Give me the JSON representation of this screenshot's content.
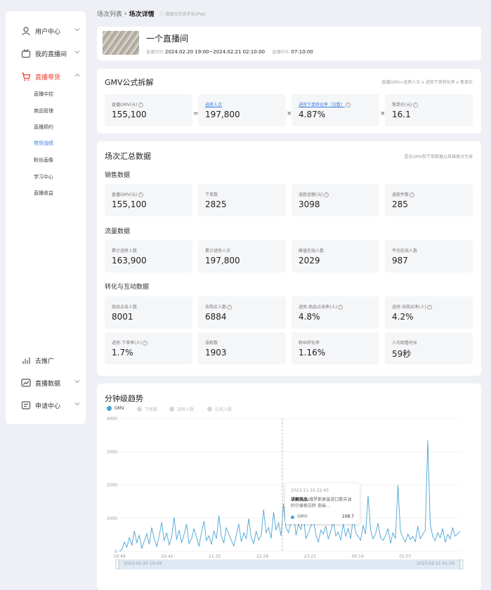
{
  "sidebar": {
    "items": [
      {
        "label": "用户中心",
        "icon": "user-circle-icon"
      },
      {
        "label": "我的直播间",
        "icon": "live-room-icon"
      },
      {
        "label": "直播带货",
        "icon": "shopping-cart-icon"
      },
      {
        "label": "去推广",
        "icon": "bar-chart-icon"
      },
      {
        "label": "直播数据",
        "icon": "line-chart-icon"
      },
      {
        "label": "申请中心",
        "icon": "application-icon"
      }
    ],
    "sub_items": [
      "直播中控",
      "商品管理",
      "直播预约",
      "带货战绩",
      "粉丝画像",
      "学习中心",
      "直播收益"
    ],
    "active_color": "#e8402f"
  },
  "breadcrumb": {
    "parent": "场次列表",
    "current": "场次详情",
    "hint": "数据仅包含手机/iPad"
  },
  "room": {
    "name": "一个直播间",
    "time_key": "直播时间",
    "time_value": "2024.02.20 19:00~2024.02.21 02:10:00",
    "duration_key": "直播时长",
    "duration_value": "07:10:00"
  },
  "gmv": {
    "title": "GMV公式拆解",
    "note": "直播GMV=进房人次 x 进房下单转化率 x 笔单价",
    "items": [
      {
        "label": "直播GMV(元)",
        "value": "155,100",
        "link": false
      },
      {
        "label": "进房人次",
        "value": "197,800",
        "link": true
      },
      {
        "label": "进房下单转化率（次数）",
        "value": "4.87%",
        "link": true
      },
      {
        "label": "笔单价(元)",
        "value": "16.1",
        "link": false
      }
    ],
    "ops": [
      "=",
      "×",
      "×"
    ]
  },
  "summary": {
    "title": "场次汇总数据",
    "note": "混全GMV和下单数据以其维度分为准",
    "sales_label": "销售数据",
    "sales": [
      {
        "label": "直播GMV(元)",
        "value": "155,100"
      },
      {
        "label": "下单数",
        "value": "2825"
      },
      {
        "label": "退款金额(元)",
        "value": "3098"
      },
      {
        "label": "退款件数",
        "value": "285"
      }
    ],
    "traffic_label": "流量数据",
    "traffic": [
      {
        "label": "累计进房人数",
        "value": "163,900"
      },
      {
        "label": "累计进房人次",
        "value": "197,800"
      },
      {
        "label": "峰值在线人数",
        "value": "2029"
      },
      {
        "label": "平均在线人数",
        "value": "987"
      }
    ],
    "conversion_label": "转化与互动数据",
    "conversion": [
      {
        "label": "商品点击人数",
        "value": "8001"
      },
      {
        "label": "去购买人数",
        "value": "6884"
      },
      {
        "label": "进房-商品点击率(人)",
        "value": "4.8%"
      },
      {
        "label": "进房-去购买率(人)",
        "value": "4.2%"
      },
      {
        "label": "进房-下单率(人)",
        "value": "1.7%"
      },
      {
        "label": "涨粉数",
        "value": "1903"
      },
      {
        "label": "粉丝转化率",
        "value": "1.16%"
      },
      {
        "label": "人均观看时长",
        "value": "59秒"
      }
    ]
  },
  "trend": {
    "title": "分钟级趋势",
    "legend": [
      "GMV",
      "下单数",
      "进房人数",
      "在线人数"
    ],
    "tooltip": {
      "time": "2023-11-10 22:45",
      "product_label": "讲解商品:",
      "product": "俄罗斯原装进口紫苏油 阿尔泰紫苏籽 亚麻...",
      "key": "GMV:",
      "value": "108.7"
    },
    "slider_start": "2023-02-20 19:49",
    "slider_end": "2023-02-21 01:59"
  },
  "chart_data": {
    "type": "line",
    "title": "分钟级趋势",
    "xlabel": "",
    "ylabel": "",
    "ylim": [
      0,
      4000
    ],
    "yticks": [
      "0",
      "1000",
      "2000",
      "3000",
      "4000"
    ],
    "xticks": [
      "19:49",
      "20:42",
      "21:35",
      "22:28",
      "23:21",
      "00:14",
      "01:07"
    ],
    "series": [
      {
        "name": "GMV",
        "color": "#4aa3d4",
        "values": [
          0,
          50,
          280,
          120,
          420,
          180,
          620,
          260,
          480,
          90,
          310,
          530,
          210,
          720,
          380,
          150,
          460,
          880,
          320,
          560,
          190,
          410,
          1020,
          350,
          640,
          270,
          500,
          820,
          230,
          380,
          690,
          420,
          150,
          560,
          910,
          330,
          470,
          210,
          620,
          380,
          1080,
          450,
          260,
          710,
          520,
          340,
          160,
          480,
          830,
          290,
          560,
          370,
          990,
          420,
          230,
          610,
          350,
          480,
          1260,
          560,
          720,
          390,
          1180,
          640,
          860,
          470,
          1430,
          720,
          560,
          910,
          1210,
          480,
          820,
          660,
          1040,
          390,
          560,
          760,
          930,
          500,
          280,
          640,
          520,
          760,
          380,
          610,
          930,
          470,
          580,
          340,
          820,
          460,
          690,
          380,
          1030,
          560,
          450,
          330,
          780,
          520,
          1680,
          640,
          380,
          520,
          850,
          410,
          330,
          470,
          690,
          240,
          560,
          380,
          2000,
          620,
          410,
          280,
          520,
          360,
          450,
          290,
          760,
          380,
          510,
          640,
          3350,
          820,
          450,
          320,
          560,
          410,
          690,
          280,
          510,
          380,
          720,
          460,
          530,
          610
        ]
      }
    ]
  }
}
